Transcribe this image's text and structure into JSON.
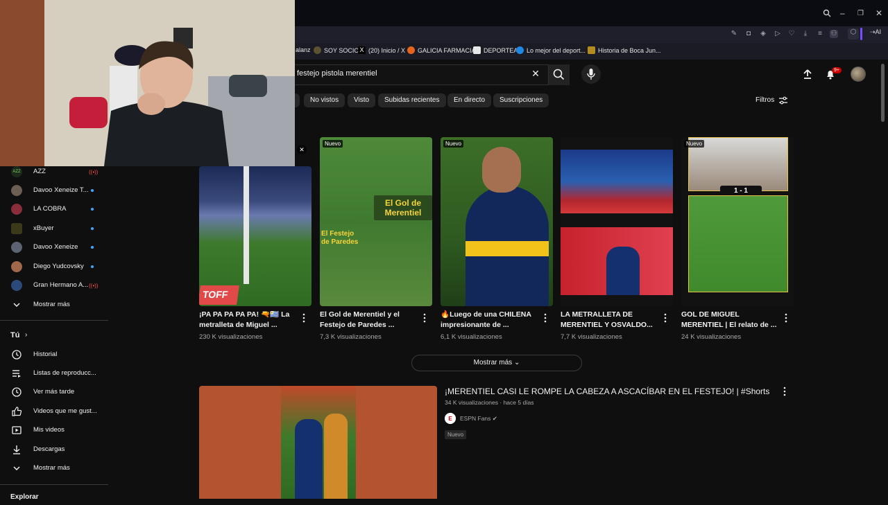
{
  "browser": {
    "bookmarks": [
      {
        "label": "alanz",
        "icon": "bookmark-icon"
      },
      {
        "label": "SOY SOCIO",
        "icon": "shield-icon"
      },
      {
        "label": "(20) Inicio / X",
        "icon": "x-logo-icon"
      },
      {
        "label": "GALICIA FARMACIA",
        "icon": "pharmacy-icon"
      },
      {
        "label": "DEPORTEA",
        "icon": "deportea-icon"
      },
      {
        "label": "Lo mejor del deport...",
        "icon": "sport-icon"
      },
      {
        "label": "Historia de Boca Jun...",
        "icon": "boca-crest-icon"
      }
    ],
    "ai_label": "AI"
  },
  "search": {
    "query": "festejo pistola merentiel",
    "notif_count": "9+"
  },
  "chips": [
    "No vistos",
    "Visto",
    "Subidas recientes",
    "En directo",
    "Suscripciones"
  ],
  "filters_label": "Filtros",
  "sidebar": {
    "subscriptions": [
      {
        "label": "AZZ",
        "status": "live"
      },
      {
        "label": "Davoo Xeneize T...",
        "status": "dot"
      },
      {
        "label": "LA COBRA",
        "status": "dot"
      },
      {
        "label": "xBuyer",
        "status": "dot"
      },
      {
        "label": "Davoo Xeneize",
        "status": "dot"
      },
      {
        "label": "Diego Yudcovsky",
        "status": "dot"
      },
      {
        "label": "Gran Hermano A...",
        "status": "live"
      }
    ],
    "show_more_subs": "Mostrar más",
    "you_label": "Tú",
    "you_items": [
      {
        "label": "Historial",
        "icon": "history-icon"
      },
      {
        "label": "Listas de reproducc...",
        "icon": "playlist-icon"
      },
      {
        "label": "Ver más tarde",
        "icon": "clock-icon"
      },
      {
        "label": "Videos que me gust...",
        "icon": "thumbs-up-icon"
      },
      {
        "label": "Mis videos",
        "icon": "my-videos-icon"
      },
      {
        "label": "Descargas",
        "icon": "download-icon"
      }
    ],
    "show_more_you": "Mostrar más",
    "explore_label": "Explorar"
  },
  "videos": [
    {
      "title": "¡PA PA PA PA PA! 🔫🇺🇾 La metralleta de Miguel ...",
      "views": "230 K visualizaciones",
      "new": false,
      "thumb_text": "TOFF"
    },
    {
      "title": "El Gol de Merentiel y el Festejo de Paredes ...",
      "views": "7,3 K visualizaciones",
      "new": true,
      "thumb_text_1": "El Gol de Merentiel",
      "thumb_text_2": "El Festejo de Paredes"
    },
    {
      "title": "🔥Luego de una CHILENA impresionante de ...",
      "views": "6,1 K visualizaciones",
      "new": true
    },
    {
      "title": "LA METRALLETA DE MERENTIEL Y OSVALDO...",
      "views": "7,7 K visualizaciones",
      "new": false
    },
    {
      "title": "GOL DE MIGUEL MERENTIEL | El relato de ...",
      "views": "24 K visualizaciones",
      "new": true,
      "score": "1 - 1"
    }
  ],
  "show_more": "Mostrar más",
  "shorts": {
    "title": "¡MERENTIEL CASI LE ROMPE LA CABEZA A ASCACÍBAR EN EL FESTEJO! | #Shorts",
    "meta": "34 K visualizaciones · hace 5 días",
    "channel": "ESPN Fans",
    "badge": "Nuevo"
  },
  "new_badge": "Nuevo",
  "colors": {
    "accent": "#3ea6ff",
    "live": "#ff4e45",
    "badge": "#cc0000",
    "bg": "#0f0f0f"
  }
}
